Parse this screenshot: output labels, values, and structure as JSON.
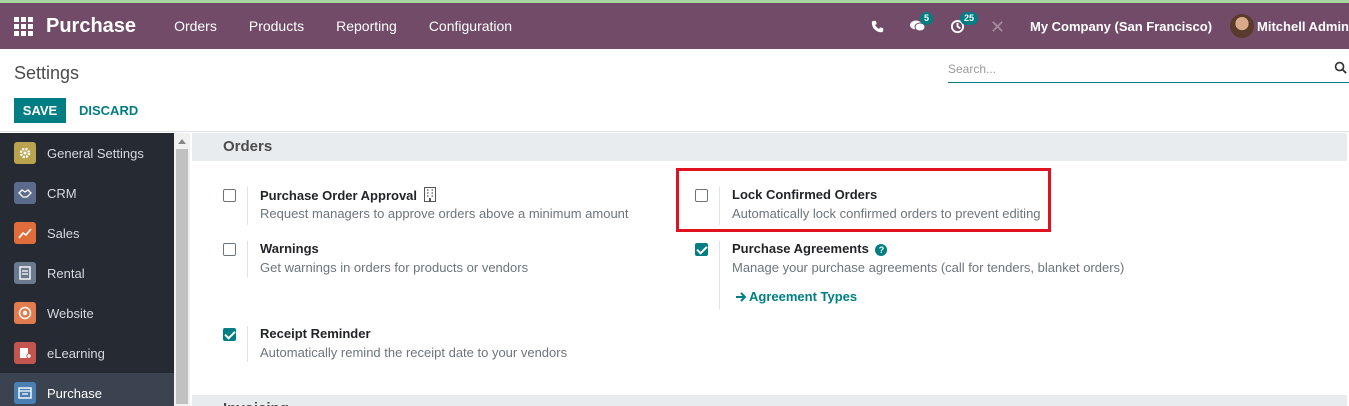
{
  "navbar": {
    "app_title": "Purchase",
    "menu": [
      "Orders",
      "Products",
      "Reporting",
      "Configuration"
    ],
    "messages_count": "5",
    "activities_count": "25",
    "company": "My Company (San Francisco)",
    "user": "Mitchell Admin"
  },
  "control_panel": {
    "title": "Settings",
    "search_placeholder": "Search...",
    "save_label": "SAVE",
    "discard_label": "DISCARD"
  },
  "sidebar": {
    "items": [
      {
        "label": "General Settings",
        "icon": "gear-icon",
        "color": "#b9a34f"
      },
      {
        "label": "CRM",
        "icon": "handshake-icon",
        "color": "#5b6b8c"
      },
      {
        "label": "Sales",
        "icon": "chart-icon",
        "color": "#e06c3c"
      },
      {
        "label": "Rental",
        "icon": "document-icon",
        "color": "#6b7a8f"
      },
      {
        "label": "Website",
        "icon": "globe-icon",
        "color": "#e27b4d"
      },
      {
        "label": "eLearning",
        "icon": "elearning-icon",
        "color": "#c2554f"
      },
      {
        "label": "Purchase",
        "icon": "purchase-icon",
        "color": "#4a7fb5"
      }
    ],
    "active": "Purchase"
  },
  "sections": {
    "orders_title": "Orders",
    "invoicing_title": "Invoicing"
  },
  "settings": {
    "po_approval": {
      "label": "Purchase Order Approval",
      "desc": "Request managers to approve orders above a minimum amount",
      "checked": false
    },
    "warnings": {
      "label": "Warnings",
      "desc": "Get warnings in orders for products or vendors",
      "checked": false
    },
    "receipt_reminder": {
      "label": "Receipt Reminder",
      "desc": "Automatically remind the receipt date to your vendors",
      "checked": true
    },
    "lock_orders": {
      "label": "Lock Confirmed Orders",
      "desc": "Automatically lock confirmed orders to prevent editing",
      "checked": false
    },
    "purchase_agreements": {
      "label": "Purchase Agreements",
      "desc": "Manage your purchase agreements (call for tenders, blanket orders)",
      "link": "Agreement Types",
      "checked": true
    }
  },
  "colors": {
    "brand": "#714b67",
    "accent": "#017e84",
    "highlight": "#e0121f"
  }
}
